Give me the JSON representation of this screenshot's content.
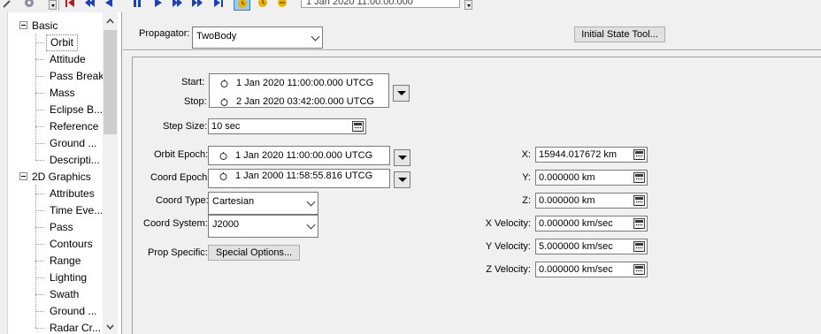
{
  "toolbar": {
    "time_display": "1 Jan 2020 11:00:00.000"
  },
  "tree": {
    "categories": [
      {
        "label": "Basic",
        "items": [
          "Orbit",
          "Attitude",
          "Pass Break",
          "Mass",
          "Eclipse B...",
          "Reference",
          "Ground ...",
          "Descripti..."
        ]
      },
      {
        "label": "2D Graphics",
        "items": [
          "Attributes",
          "Time Eve...",
          "Pass",
          "Contours",
          "Range",
          "Lighting",
          "Swath",
          "Ground ...",
          "Radar Cr..."
        ]
      }
    ],
    "selected": "Orbit"
  },
  "propagator": {
    "label": "Propagator:",
    "value": "TwoBody",
    "initial_state_button": "Initial State Tool..."
  },
  "interval": {
    "start_label": "Start:",
    "start_value": "1 Jan 2020 11:00:00.000 UTCG",
    "stop_label": "Stop:",
    "stop_value": "2 Jan 2020 03:42:00.000 UTCG"
  },
  "step": {
    "label": "Step Size:",
    "value": "10 sec"
  },
  "epochs": {
    "orbit_label": "Orbit Epoch:",
    "orbit_value": "1 Jan 2020 11:00:00.000 UTCG",
    "coord_label": "Coord Epoch:",
    "coord_value": "1 Jan 2000 11:58:55.816 UTCG"
  },
  "coord": {
    "type_label": "Coord Type:",
    "type_value": "Cartesian",
    "system_label": "Coord System:",
    "system_value": "J2000",
    "prop_specific_label": "Prop Specific:",
    "special_options_button": "Special Options..."
  },
  "state": [
    {
      "label": "X:",
      "value": "15944.017672 km"
    },
    {
      "label": "Y:",
      "value": "0.000000 km"
    },
    {
      "label": "Z:",
      "value": "0.000000 km"
    },
    {
      "label": "X Velocity:",
      "value": "0.000000 km/sec"
    },
    {
      "label": "Y Velocity:",
      "value": "5.000000 km/sec"
    },
    {
      "label": "Z Velocity:",
      "value": "0.000000 km/sec"
    }
  ],
  "colors": {
    "selected_tool_bg": "#99c7f0",
    "nav_arrow_blue": "#1a3fbf",
    "nav_red": "#c01818",
    "gold": "#e8b400"
  }
}
